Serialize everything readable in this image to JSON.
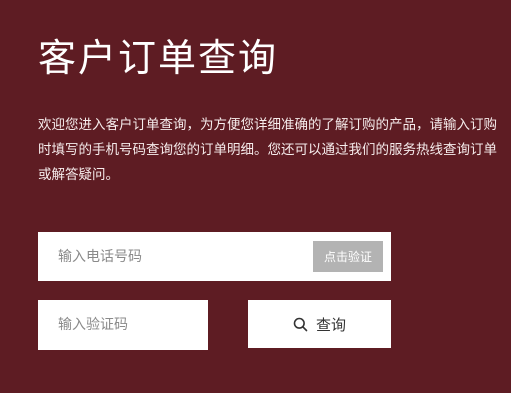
{
  "page": {
    "title": "客户订单查询",
    "intro": "欢迎您进入客户订单查询，为方便您详细准确的了解订购的产品，请输入订购时填写的手机号码查询您的订单明细。您还可以通过我们的服务热线查询订单或解答疑问。"
  },
  "form": {
    "phone_placeholder": "输入电话号码",
    "verify_button_label": "点击验证",
    "code_placeholder": "输入验证码",
    "query_button_label": "查询"
  },
  "icons": {
    "query": "search-icon"
  },
  "colors": {
    "background": "#5e1c23",
    "field_background": "#ffffff",
    "verify_button": "#b3b3b3",
    "text_on_dark": "#ffffff"
  }
}
